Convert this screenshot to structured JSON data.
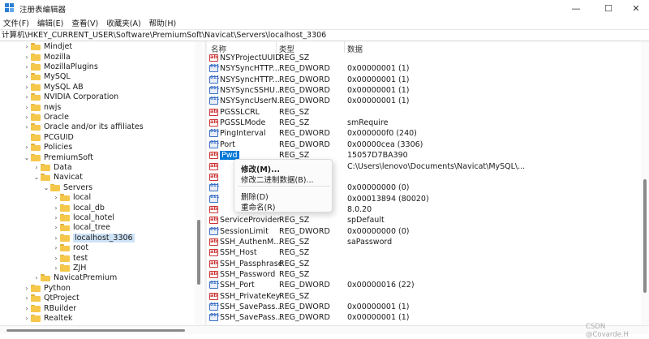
{
  "window": {
    "title": "注册表编辑器",
    "minimize": "—",
    "maximize": "☐",
    "close": "✕"
  },
  "menu": [
    "文件(F)",
    "编辑(E)",
    "查看(V)",
    "收藏夹(A)",
    "帮助(H)"
  ],
  "address": "计算机\\HKEY_CURRENT_USER\\Software\\PremiumSoft\\Navicat\\Servers\\localhost_3306",
  "tree": [
    {
      "label": "Mindjet",
      "chevron": "›"
    },
    {
      "label": "Mozilla",
      "chevron": "›"
    },
    {
      "label": "MozillaPlugins",
      "chevron": "›"
    },
    {
      "label": "MySQL",
      "chevron": "›"
    },
    {
      "label": "MySQL AB",
      "chevron": "›"
    },
    {
      "label": "NVIDIA Corporation",
      "chevron": "›"
    },
    {
      "label": "nwjs",
      "chevron": "›"
    },
    {
      "label": "Oracle",
      "chevron": "›"
    },
    {
      "label": "Oracle and/or its affiliates",
      "chevron": "›"
    },
    {
      "label": "PCGUID",
      "chevron": ""
    },
    {
      "label": "Policies",
      "chevron": "›"
    },
    {
      "label": "PremiumSoft",
      "chevron": "⌄"
    },
    {
      "label": "Data",
      "chevron": "›"
    },
    {
      "label": "Navicat",
      "chevron": "⌄"
    },
    {
      "label": "Servers",
      "chevron": "⌄"
    },
    {
      "label": "local",
      "chevron": "›"
    },
    {
      "label": "local_db",
      "chevron": "›"
    },
    {
      "label": "local_hotel",
      "chevron": "›"
    },
    {
      "label": "local_tree",
      "chevron": "›"
    },
    {
      "label": "localhost_3306",
      "chevron": "›",
      "selected": true
    },
    {
      "label": "root",
      "chevron": "›"
    },
    {
      "label": "test",
      "chevron": "›"
    },
    {
      "label": "ZJH",
      "chevron": "›"
    },
    {
      "label": "NavicatPremium",
      "chevron": "›"
    },
    {
      "label": "Python",
      "chevron": "›"
    },
    {
      "label": "QtProject",
      "chevron": "›"
    },
    {
      "label": "RBuilder",
      "chevron": "›"
    },
    {
      "label": "Realtek",
      "chevron": "›"
    }
  ],
  "columns": {
    "name": "名称",
    "type": "类型",
    "data": "数据"
  },
  "values": [
    {
      "name": "NSYProjectUUID",
      "type": "REG_SZ",
      "data": "",
      "icon": "sz"
    },
    {
      "name": "NSYSyncHTTP...",
      "type": "REG_DWORD",
      "data": "0x00000001 (1)",
      "icon": "dw"
    },
    {
      "name": "NSYSyncHTTP...",
      "type": "REG_DWORD",
      "data": "0x00000001 (1)",
      "icon": "dw"
    },
    {
      "name": "NSYSyncSSHU...",
      "type": "REG_DWORD",
      "data": "0x00000001 (1)",
      "icon": "dw"
    },
    {
      "name": "NSYSyncUserN...",
      "type": "REG_DWORD",
      "data": "0x00000001 (1)",
      "icon": "dw"
    },
    {
      "name": "PGSSLCRL",
      "type": "REG_SZ",
      "data": "",
      "icon": "sz"
    },
    {
      "name": "PGSSLMode",
      "type": "REG_SZ",
      "data": "smRequire",
      "icon": "sz"
    },
    {
      "name": "PingInterval",
      "type": "REG_DWORD",
      "data": "0x000000f0 (240)",
      "icon": "dw"
    },
    {
      "name": "Port",
      "type": "REG_DWORD",
      "data": "0x00000cea (3306)",
      "icon": "dw"
    },
    {
      "name": "Pwd",
      "type": "REG_SZ",
      "data": "15057D7BA390",
      "icon": "sz",
      "selected": true
    },
    {
      "name": "",
      "type": "",
      "data": "C:\\Users\\lenovo\\Documents\\Navicat\\MySQL\\...",
      "icon": "sz"
    },
    {
      "name": "",
      "type": "",
      "data": "",
      "icon": "sz"
    },
    {
      "name": "",
      "type": "",
      "data": "0x00000000 (0)",
      "icon": "dw"
    },
    {
      "name": "",
      "type": "",
      "data": "0x00013894 (80020)",
      "icon": "dw"
    },
    {
      "name": "",
      "type": "",
      "data": "8.0.20",
      "icon": "sz"
    },
    {
      "name": "ServiceProvider",
      "type": "REG_SZ",
      "data": "spDefault",
      "icon": "sz"
    },
    {
      "name": "SessionLimit",
      "type": "REG_DWORD",
      "data": "0x00000000 (0)",
      "icon": "dw"
    },
    {
      "name": "SSH_AuthenM...",
      "type": "REG_SZ",
      "data": "saPassword",
      "icon": "sz"
    },
    {
      "name": "SSH_Host",
      "type": "REG_SZ",
      "data": "",
      "icon": "sz"
    },
    {
      "name": "SSH_Passphrase",
      "type": "REG_SZ",
      "data": "",
      "icon": "sz"
    },
    {
      "name": "SSH_Password",
      "type": "REG_SZ",
      "data": "",
      "icon": "sz"
    },
    {
      "name": "SSH_Port",
      "type": "REG_DWORD",
      "data": "0x00000016 (22)",
      "icon": "dw"
    },
    {
      "name": "SSH_PrivateKey",
      "type": "REG_SZ",
      "data": "",
      "icon": "sz"
    },
    {
      "name": "SSH_SavePass...",
      "type": "REG_DWORD",
      "data": "0x00000001 (1)",
      "icon": "dw"
    },
    {
      "name": "SSH_SavePass...",
      "type": "REG_DWORD",
      "data": "0x00000001 (1)",
      "icon": "dw"
    },
    {
      "name": "SSH_UserName",
      "type": "REG_SZ",
      "data": "",
      "icon": "sz"
    }
  ],
  "context_menu": {
    "modify": "修改(M)...",
    "modify_binary": "修改二进制数据(B)...",
    "delete": "删除(D)",
    "rename": "重命名(R)"
  },
  "watermark": "CSDN @Covarde.H"
}
